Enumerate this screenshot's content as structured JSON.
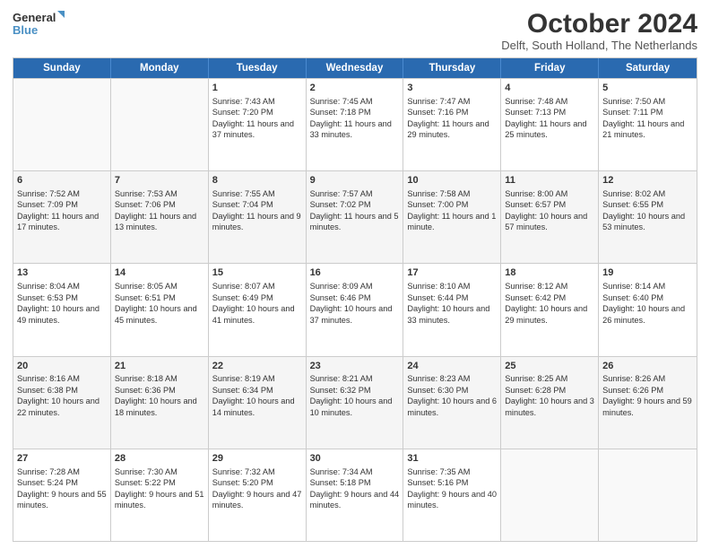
{
  "logo": {
    "line1": "General",
    "line2": "Blue"
  },
  "title": "October 2024",
  "location": "Delft, South Holland, The Netherlands",
  "headers": [
    "Sunday",
    "Monday",
    "Tuesday",
    "Wednesday",
    "Thursday",
    "Friday",
    "Saturday"
  ],
  "weeks": [
    [
      {
        "day": "",
        "sunrise": "",
        "sunset": "",
        "daylight": ""
      },
      {
        "day": "",
        "sunrise": "",
        "sunset": "",
        "daylight": ""
      },
      {
        "day": "1",
        "sunrise": "Sunrise: 7:43 AM",
        "sunset": "Sunset: 7:20 PM",
        "daylight": "Daylight: 11 hours and 37 minutes."
      },
      {
        "day": "2",
        "sunrise": "Sunrise: 7:45 AM",
        "sunset": "Sunset: 7:18 PM",
        "daylight": "Daylight: 11 hours and 33 minutes."
      },
      {
        "day": "3",
        "sunrise": "Sunrise: 7:47 AM",
        "sunset": "Sunset: 7:16 PM",
        "daylight": "Daylight: 11 hours and 29 minutes."
      },
      {
        "day": "4",
        "sunrise": "Sunrise: 7:48 AM",
        "sunset": "Sunset: 7:13 PM",
        "daylight": "Daylight: 11 hours and 25 minutes."
      },
      {
        "day": "5",
        "sunrise": "Sunrise: 7:50 AM",
        "sunset": "Sunset: 7:11 PM",
        "daylight": "Daylight: 11 hours and 21 minutes."
      }
    ],
    [
      {
        "day": "6",
        "sunrise": "Sunrise: 7:52 AM",
        "sunset": "Sunset: 7:09 PM",
        "daylight": "Daylight: 11 hours and 17 minutes."
      },
      {
        "day": "7",
        "sunrise": "Sunrise: 7:53 AM",
        "sunset": "Sunset: 7:06 PM",
        "daylight": "Daylight: 11 hours and 13 minutes."
      },
      {
        "day": "8",
        "sunrise": "Sunrise: 7:55 AM",
        "sunset": "Sunset: 7:04 PM",
        "daylight": "Daylight: 11 hours and 9 minutes."
      },
      {
        "day": "9",
        "sunrise": "Sunrise: 7:57 AM",
        "sunset": "Sunset: 7:02 PM",
        "daylight": "Daylight: 11 hours and 5 minutes."
      },
      {
        "day": "10",
        "sunrise": "Sunrise: 7:58 AM",
        "sunset": "Sunset: 7:00 PM",
        "daylight": "Daylight: 11 hours and 1 minute."
      },
      {
        "day": "11",
        "sunrise": "Sunrise: 8:00 AM",
        "sunset": "Sunset: 6:57 PM",
        "daylight": "Daylight: 10 hours and 57 minutes."
      },
      {
        "day": "12",
        "sunrise": "Sunrise: 8:02 AM",
        "sunset": "Sunset: 6:55 PM",
        "daylight": "Daylight: 10 hours and 53 minutes."
      }
    ],
    [
      {
        "day": "13",
        "sunrise": "Sunrise: 8:04 AM",
        "sunset": "Sunset: 6:53 PM",
        "daylight": "Daylight: 10 hours and 49 minutes."
      },
      {
        "day": "14",
        "sunrise": "Sunrise: 8:05 AM",
        "sunset": "Sunset: 6:51 PM",
        "daylight": "Daylight: 10 hours and 45 minutes."
      },
      {
        "day": "15",
        "sunrise": "Sunrise: 8:07 AM",
        "sunset": "Sunset: 6:49 PM",
        "daylight": "Daylight: 10 hours and 41 minutes."
      },
      {
        "day": "16",
        "sunrise": "Sunrise: 8:09 AM",
        "sunset": "Sunset: 6:46 PM",
        "daylight": "Daylight: 10 hours and 37 minutes."
      },
      {
        "day": "17",
        "sunrise": "Sunrise: 8:10 AM",
        "sunset": "Sunset: 6:44 PM",
        "daylight": "Daylight: 10 hours and 33 minutes."
      },
      {
        "day": "18",
        "sunrise": "Sunrise: 8:12 AM",
        "sunset": "Sunset: 6:42 PM",
        "daylight": "Daylight: 10 hours and 29 minutes."
      },
      {
        "day": "19",
        "sunrise": "Sunrise: 8:14 AM",
        "sunset": "Sunset: 6:40 PM",
        "daylight": "Daylight: 10 hours and 26 minutes."
      }
    ],
    [
      {
        "day": "20",
        "sunrise": "Sunrise: 8:16 AM",
        "sunset": "Sunset: 6:38 PM",
        "daylight": "Daylight: 10 hours and 22 minutes."
      },
      {
        "day": "21",
        "sunrise": "Sunrise: 8:18 AM",
        "sunset": "Sunset: 6:36 PM",
        "daylight": "Daylight: 10 hours and 18 minutes."
      },
      {
        "day": "22",
        "sunrise": "Sunrise: 8:19 AM",
        "sunset": "Sunset: 6:34 PM",
        "daylight": "Daylight: 10 hours and 14 minutes."
      },
      {
        "day": "23",
        "sunrise": "Sunrise: 8:21 AM",
        "sunset": "Sunset: 6:32 PM",
        "daylight": "Daylight: 10 hours and 10 minutes."
      },
      {
        "day": "24",
        "sunrise": "Sunrise: 8:23 AM",
        "sunset": "Sunset: 6:30 PM",
        "daylight": "Daylight: 10 hours and 6 minutes."
      },
      {
        "day": "25",
        "sunrise": "Sunrise: 8:25 AM",
        "sunset": "Sunset: 6:28 PM",
        "daylight": "Daylight: 10 hours and 3 minutes."
      },
      {
        "day": "26",
        "sunrise": "Sunrise: 8:26 AM",
        "sunset": "Sunset: 6:26 PM",
        "daylight": "Daylight: 9 hours and 59 minutes."
      }
    ],
    [
      {
        "day": "27",
        "sunrise": "Sunrise: 7:28 AM",
        "sunset": "Sunset: 5:24 PM",
        "daylight": "Daylight: 9 hours and 55 minutes."
      },
      {
        "day": "28",
        "sunrise": "Sunrise: 7:30 AM",
        "sunset": "Sunset: 5:22 PM",
        "daylight": "Daylight: 9 hours and 51 minutes."
      },
      {
        "day": "29",
        "sunrise": "Sunrise: 7:32 AM",
        "sunset": "Sunset: 5:20 PM",
        "daylight": "Daylight: 9 hours and 47 minutes."
      },
      {
        "day": "30",
        "sunrise": "Sunrise: 7:34 AM",
        "sunset": "Sunset: 5:18 PM",
        "daylight": "Daylight: 9 hours and 44 minutes."
      },
      {
        "day": "31",
        "sunrise": "Sunrise: 7:35 AM",
        "sunset": "Sunset: 5:16 PM",
        "daylight": "Daylight: 9 hours and 40 minutes."
      },
      {
        "day": "",
        "sunrise": "",
        "sunset": "",
        "daylight": ""
      },
      {
        "day": "",
        "sunrise": "",
        "sunset": "",
        "daylight": ""
      }
    ]
  ]
}
